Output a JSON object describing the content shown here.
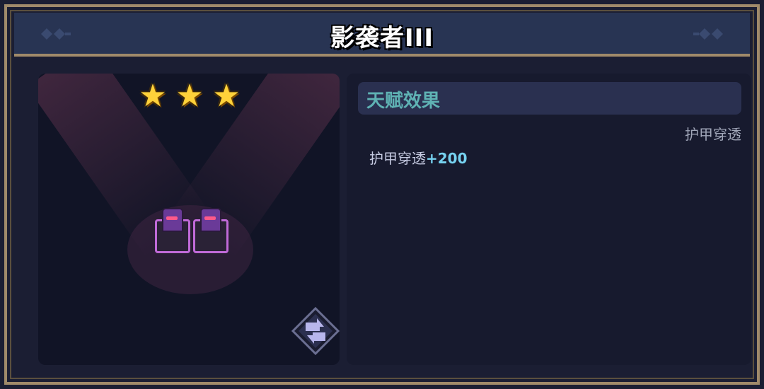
{
  "header": {
    "title": "影袭者III"
  },
  "preview": {
    "star_count": 3,
    "stars": [
      "★",
      "★",
      "★"
    ],
    "unit_count": 2,
    "swap_icon": "swap-arrows-icon"
  },
  "talent": {
    "section_title": "天赋效果",
    "name": "护甲穿透",
    "effect_label": "护甲穿透",
    "effect_value": "+200"
  },
  "colors": {
    "accent_teal": "#5fb2b4",
    "value_cyan": "#76d2f0",
    "border_gold": "#a08a6a",
    "star_gold": "#ffd23a"
  }
}
